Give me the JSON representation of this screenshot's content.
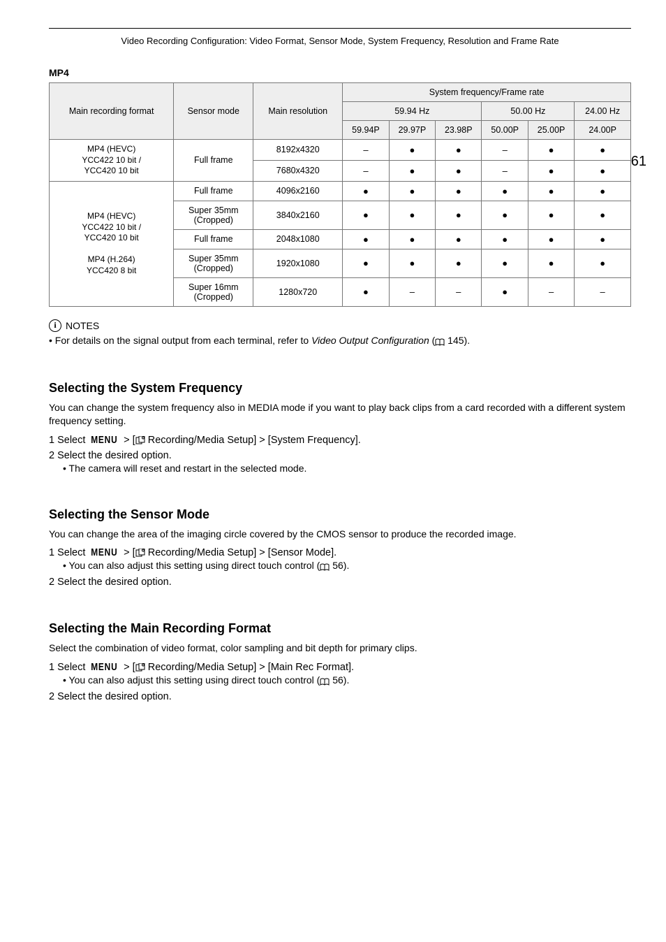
{
  "header": {
    "title": "Video Recording Configuration: Video Format, Sensor Mode, System Frequency, Resolution and Frame Rate"
  },
  "page_number": "61",
  "section_label": "MP4",
  "table": {
    "col_headers": {
      "format": "Main recording format",
      "sensor": "Sensor mode",
      "resolution": "Main resolution",
      "sysfreq": "System frequency/Frame rate",
      "g1": "59.94 Hz",
      "g2": "50.00 Hz",
      "g3": "24.00 Hz",
      "c1": "59.94P",
      "c2": "29.97P",
      "c3": "23.98P",
      "c4": "50.00P",
      "c5": "25.00P",
      "c6": "24.00P"
    },
    "formats": {
      "f1": "MP4 (HEVC)\nYCC422 10 bit /\nYCC420 10 bit",
      "f2a": "MP4 (HEVC)\nYCC422 10 bit /\nYCC420 10 bit",
      "f2b": "MP4 (H.264)\nYCC420 8 bit"
    },
    "rows": [
      {
        "sensor": "Full frame",
        "res": "8192x4320",
        "v": [
          "–",
          "●",
          "●",
          "–",
          "●",
          "●"
        ]
      },
      {
        "sensor": "",
        "res": "7680x4320",
        "v": [
          "–",
          "●",
          "●",
          "–",
          "●",
          "●"
        ]
      },
      {
        "sensor": "Full frame",
        "res": "4096x2160",
        "v": [
          "●",
          "●",
          "●",
          "●",
          "●",
          "●"
        ]
      },
      {
        "sensor": "Super 35mm\n(Cropped)",
        "res": "3840x2160",
        "v": [
          "●",
          "●",
          "●",
          "●",
          "●",
          "●"
        ]
      },
      {
        "sensor": "Full frame",
        "res": "2048x1080",
        "v": [
          "●",
          "●",
          "●",
          "●",
          "●",
          "●"
        ]
      },
      {
        "sensor": "Super 35mm\n(Cropped)",
        "res": "1920x1080",
        "v": [
          "●",
          "●",
          "●",
          "●",
          "●",
          "●"
        ]
      },
      {
        "sensor": "Super 16mm\n(Cropped)",
        "res": "1280x720",
        "v": [
          "●",
          "–",
          "–",
          "●",
          "–",
          "–"
        ]
      }
    ]
  },
  "notes": {
    "label": "NOTES",
    "line_prefix": "• For details on the signal output from each terminal, refer to ",
    "line_italic": "Video Output Configuration",
    "line_suffix_open": " (",
    "line_page": " 145).",
    "line_close": ""
  },
  "sec1": {
    "title": "Selecting the System Frequency",
    "body": "You can change the system frequency also in MEDIA mode if you want to play back clips from a card recorded with a different system frequency setting.",
    "step1_prefix": "1 Select ",
    "step1_menu": "MENU",
    "step1_mid": " > [",
    "step1_path": "  Recording/Media Setup] > [System Frequency].",
    "step2": "2 Select the desired option.",
    "step2_sub": "• The camera will reset and restart in the selected mode."
  },
  "sec2": {
    "title": "Selecting the Sensor Mode",
    "body": "You can change the area of the imaging circle covered by the CMOS sensor to produce the recorded image.",
    "step1_prefix": "1 Select ",
    "step1_menu": "MENU",
    "step1_mid": " > [",
    "step1_path": "  Recording/Media Setup] > [Sensor Mode].",
    "step1_sub_prefix": "• You can also adjust this setting using direct touch control (",
    "step1_sub_page": " 56).",
    "step2": "2 Select the desired option."
  },
  "sec3": {
    "title": "Selecting the Main Recording Format",
    "body": "Select the combination of video format, color sampling and bit depth for primary clips.",
    "step1_prefix": "1 Select ",
    "step1_menu": "MENU",
    "step1_mid": " > [",
    "step1_path": "  Recording/Media Setup] > [Main Rec Format].",
    "step1_sub_prefix": "• You can also adjust this setting using direct touch control (",
    "step1_sub_page": " 56).",
    "step2": "2 Select the desired option."
  }
}
